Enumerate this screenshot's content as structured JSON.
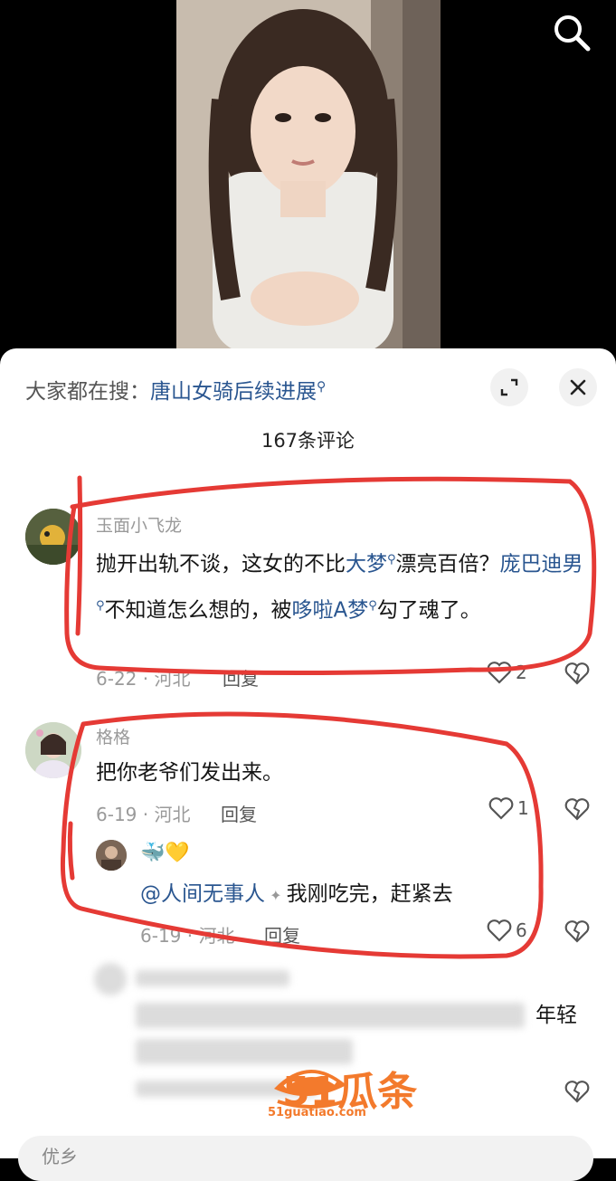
{
  "video": {
    "search_icon": "search-icon"
  },
  "panel": {
    "trending_prefix": "大家都在搜：",
    "trending_query": "唐山女骑后续进展",
    "comment_count": "167条评论",
    "expand_icon": "expand-icon",
    "close_icon": "close-icon"
  },
  "comments": [
    {
      "user": "玉面小飞龙",
      "text_parts": [
        "抛开出轨不谈，这女的不比",
        "大梦",
        "漂亮百倍？",
        "庞巴迪男",
        "不知道怎么想的，被",
        "哆啦A梦",
        "勾了魂了。"
      ],
      "date_loc": "6-22 · 河北",
      "reply": "回复",
      "likes": "2"
    },
    {
      "user": "格格",
      "text": "把你老爷们发出来。",
      "date_loc": "6-19 · 河北",
      "reply": "回复",
      "likes": "1",
      "replies": [
        {
          "user": "🐳💛",
          "mention": "@人间无事人",
          "text": "我刚吃完，赶紧去",
          "date_loc": "6-19 · 河北",
          "reply": "回复",
          "likes": "6"
        }
      ]
    }
  ],
  "blurred_tail": "年轻",
  "watermark": {
    "logo": "51瓜条",
    "url": "51guatiao.com"
  },
  "input": {
    "placeholder": "优乡"
  },
  "colors": {
    "link": "#2a5690",
    "annotation": "#e53a35",
    "watermark": "#f37a2c"
  }
}
